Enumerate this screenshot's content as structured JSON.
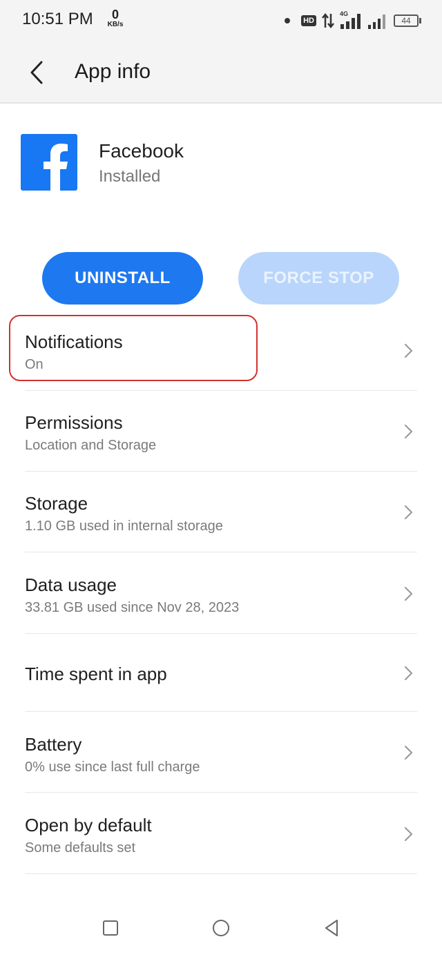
{
  "status_bar": {
    "time": "10:51 PM",
    "net_speed_value": "0",
    "net_speed_unit": "KB/s",
    "hd_label": "HD",
    "network_label": "4G",
    "battery_level": "44"
  },
  "app_bar": {
    "title": "App info"
  },
  "app": {
    "name": "Facebook",
    "status": "Installed",
    "icon_color": "#1877f2"
  },
  "actions": {
    "uninstall_label": "UNINSTALL",
    "force_stop_label": "FORCE STOP"
  },
  "settings": [
    {
      "title": "Notifications",
      "subtitle": "On"
    },
    {
      "title": "Permissions",
      "subtitle": "Location and Storage"
    },
    {
      "title": "Storage",
      "subtitle": "1.10 GB used in internal storage"
    },
    {
      "title": "Data usage",
      "subtitle": "33.81 GB used since Nov 28, 2023"
    },
    {
      "title": "Time spent in app",
      "subtitle": ""
    },
    {
      "title": "Battery",
      "subtitle": "0% use since last full charge"
    },
    {
      "title": "Open by default",
      "subtitle": "Some defaults set"
    }
  ],
  "colors": {
    "accent": "#1e78f0",
    "accent_disabled": "#b9d5fb",
    "highlight": "#d32f2f"
  }
}
